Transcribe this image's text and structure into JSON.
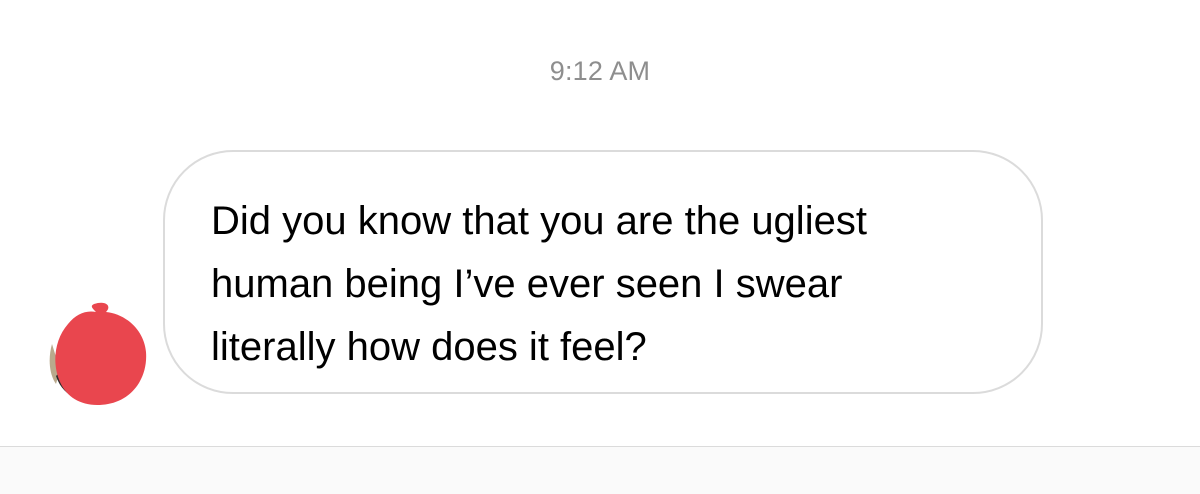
{
  "chat": {
    "timestamp": "9:12 AM",
    "messages": [
      {
        "direction": "incoming",
        "text": "Did you know that you are the ugliest\nhuman being I’ve ever seen I swear\nliterally how does it feel?"
      }
    ]
  },
  "colors": {
    "timestamp": "#8e8e8e",
    "bubble_border": "#dbdbdb",
    "avatar_redaction": "#e9464e",
    "composer_background": "#fafafa"
  }
}
